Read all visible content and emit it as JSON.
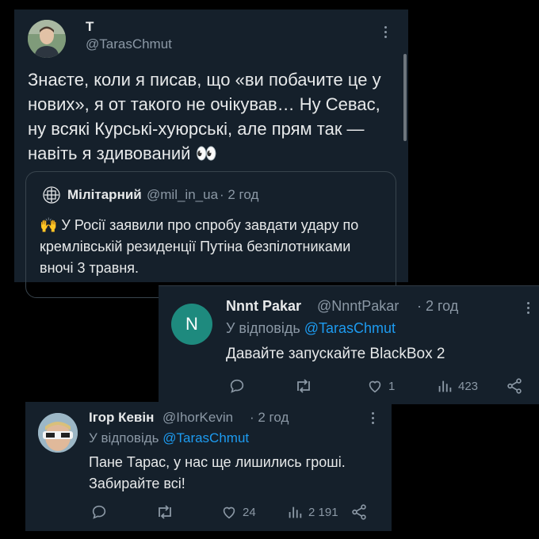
{
  "tweet": {
    "name": "Т",
    "handle": "@TarasChmut",
    "text": "Знаєте, коли я писав, що «ви побачите це у нових», я от такого не очікував… Ну Севас, ну всякі Курські-хуюрські, але прям так — навіть я здивований 👀",
    "quote": {
      "name": "Мілітарний",
      "handle": "@mil_in_ua",
      "time": "· 2 год",
      "text": "🙌 У Росії заявили про спробу завдати удару по кремлівській резиденції Путіна безпілотниками вночі 3 травня."
    }
  },
  "reply1": {
    "avatar_letter": "N",
    "name": "Nnnt Pakar",
    "handle": "@NnntPakar",
    "time": "· 2 год",
    "reply_prefix": "У відповідь",
    "reply_to": "@TarasChmut",
    "text": "Давайте запускайте BlackBox 2",
    "likes": "1",
    "views": "423"
  },
  "reply2": {
    "name": "Ігор Кевін",
    "handle": "@IhorKevin",
    "time": "· 2 год",
    "reply_prefix": "У відповідь",
    "reply_to": "@TarasChmut",
    "text": "Пане Тарас, у нас ще лишились гроші. Забирайте всі!",
    "likes": "24",
    "views": "2 191"
  },
  "colors": {
    "background": "#15202b",
    "accent": "#1d9bf0",
    "muted": "#8b98a5",
    "avatar_teal": "#1e8a7e"
  }
}
